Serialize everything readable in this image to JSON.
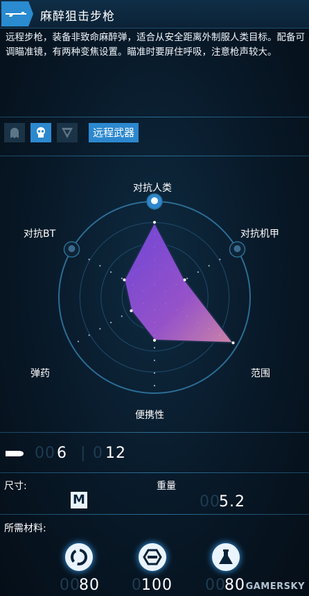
{
  "header": {
    "title": "麻醉狙击步枪",
    "icon": "sniper-rifle-icon"
  },
  "description": "远程步枪，装备非致命麻醉弹，适合从安全距离外制服人类目标。配备可调瞄准镜，有两种变焦设置。瞄准时要屏住呼吸，注意枪声较大。",
  "tags": {
    "icons": [
      "ghost-icon",
      "skull-icon",
      "mech-icon"
    ],
    "active_index": 1,
    "label": "远程武器"
  },
  "radar": {
    "axes": [
      "对抗人类",
      "对抗机甲",
      "范围",
      "便携性",
      "弹药",
      "对抗BT"
    ],
    "values": [
      0.8,
      0.3,
      1.0,
      0.4,
      0.2,
      0.3
    ],
    "accent": "#2c88cf"
  },
  "ammo": {
    "icon": "ammo-icon",
    "magazine_dim": "00",
    "magazine": "6",
    "separator": "|",
    "reserve_dim": "0",
    "reserve": "12"
  },
  "specs": {
    "size_label": "尺寸:",
    "size_value": "M",
    "weight_label": "重量",
    "weight_dim": "00",
    "weight_value": "5.2"
  },
  "materials": {
    "label": "所需材料:",
    "items": [
      {
        "icon": "chemical-material-icon",
        "dim": "00",
        "value": "80"
      },
      {
        "icon": "metal-material-icon",
        "dim": "0",
        "value": "100"
      },
      {
        "icon": "resin-material-icon",
        "dim": "00",
        "value": "80"
      }
    ]
  },
  "watermark": "GAMERSKY"
}
